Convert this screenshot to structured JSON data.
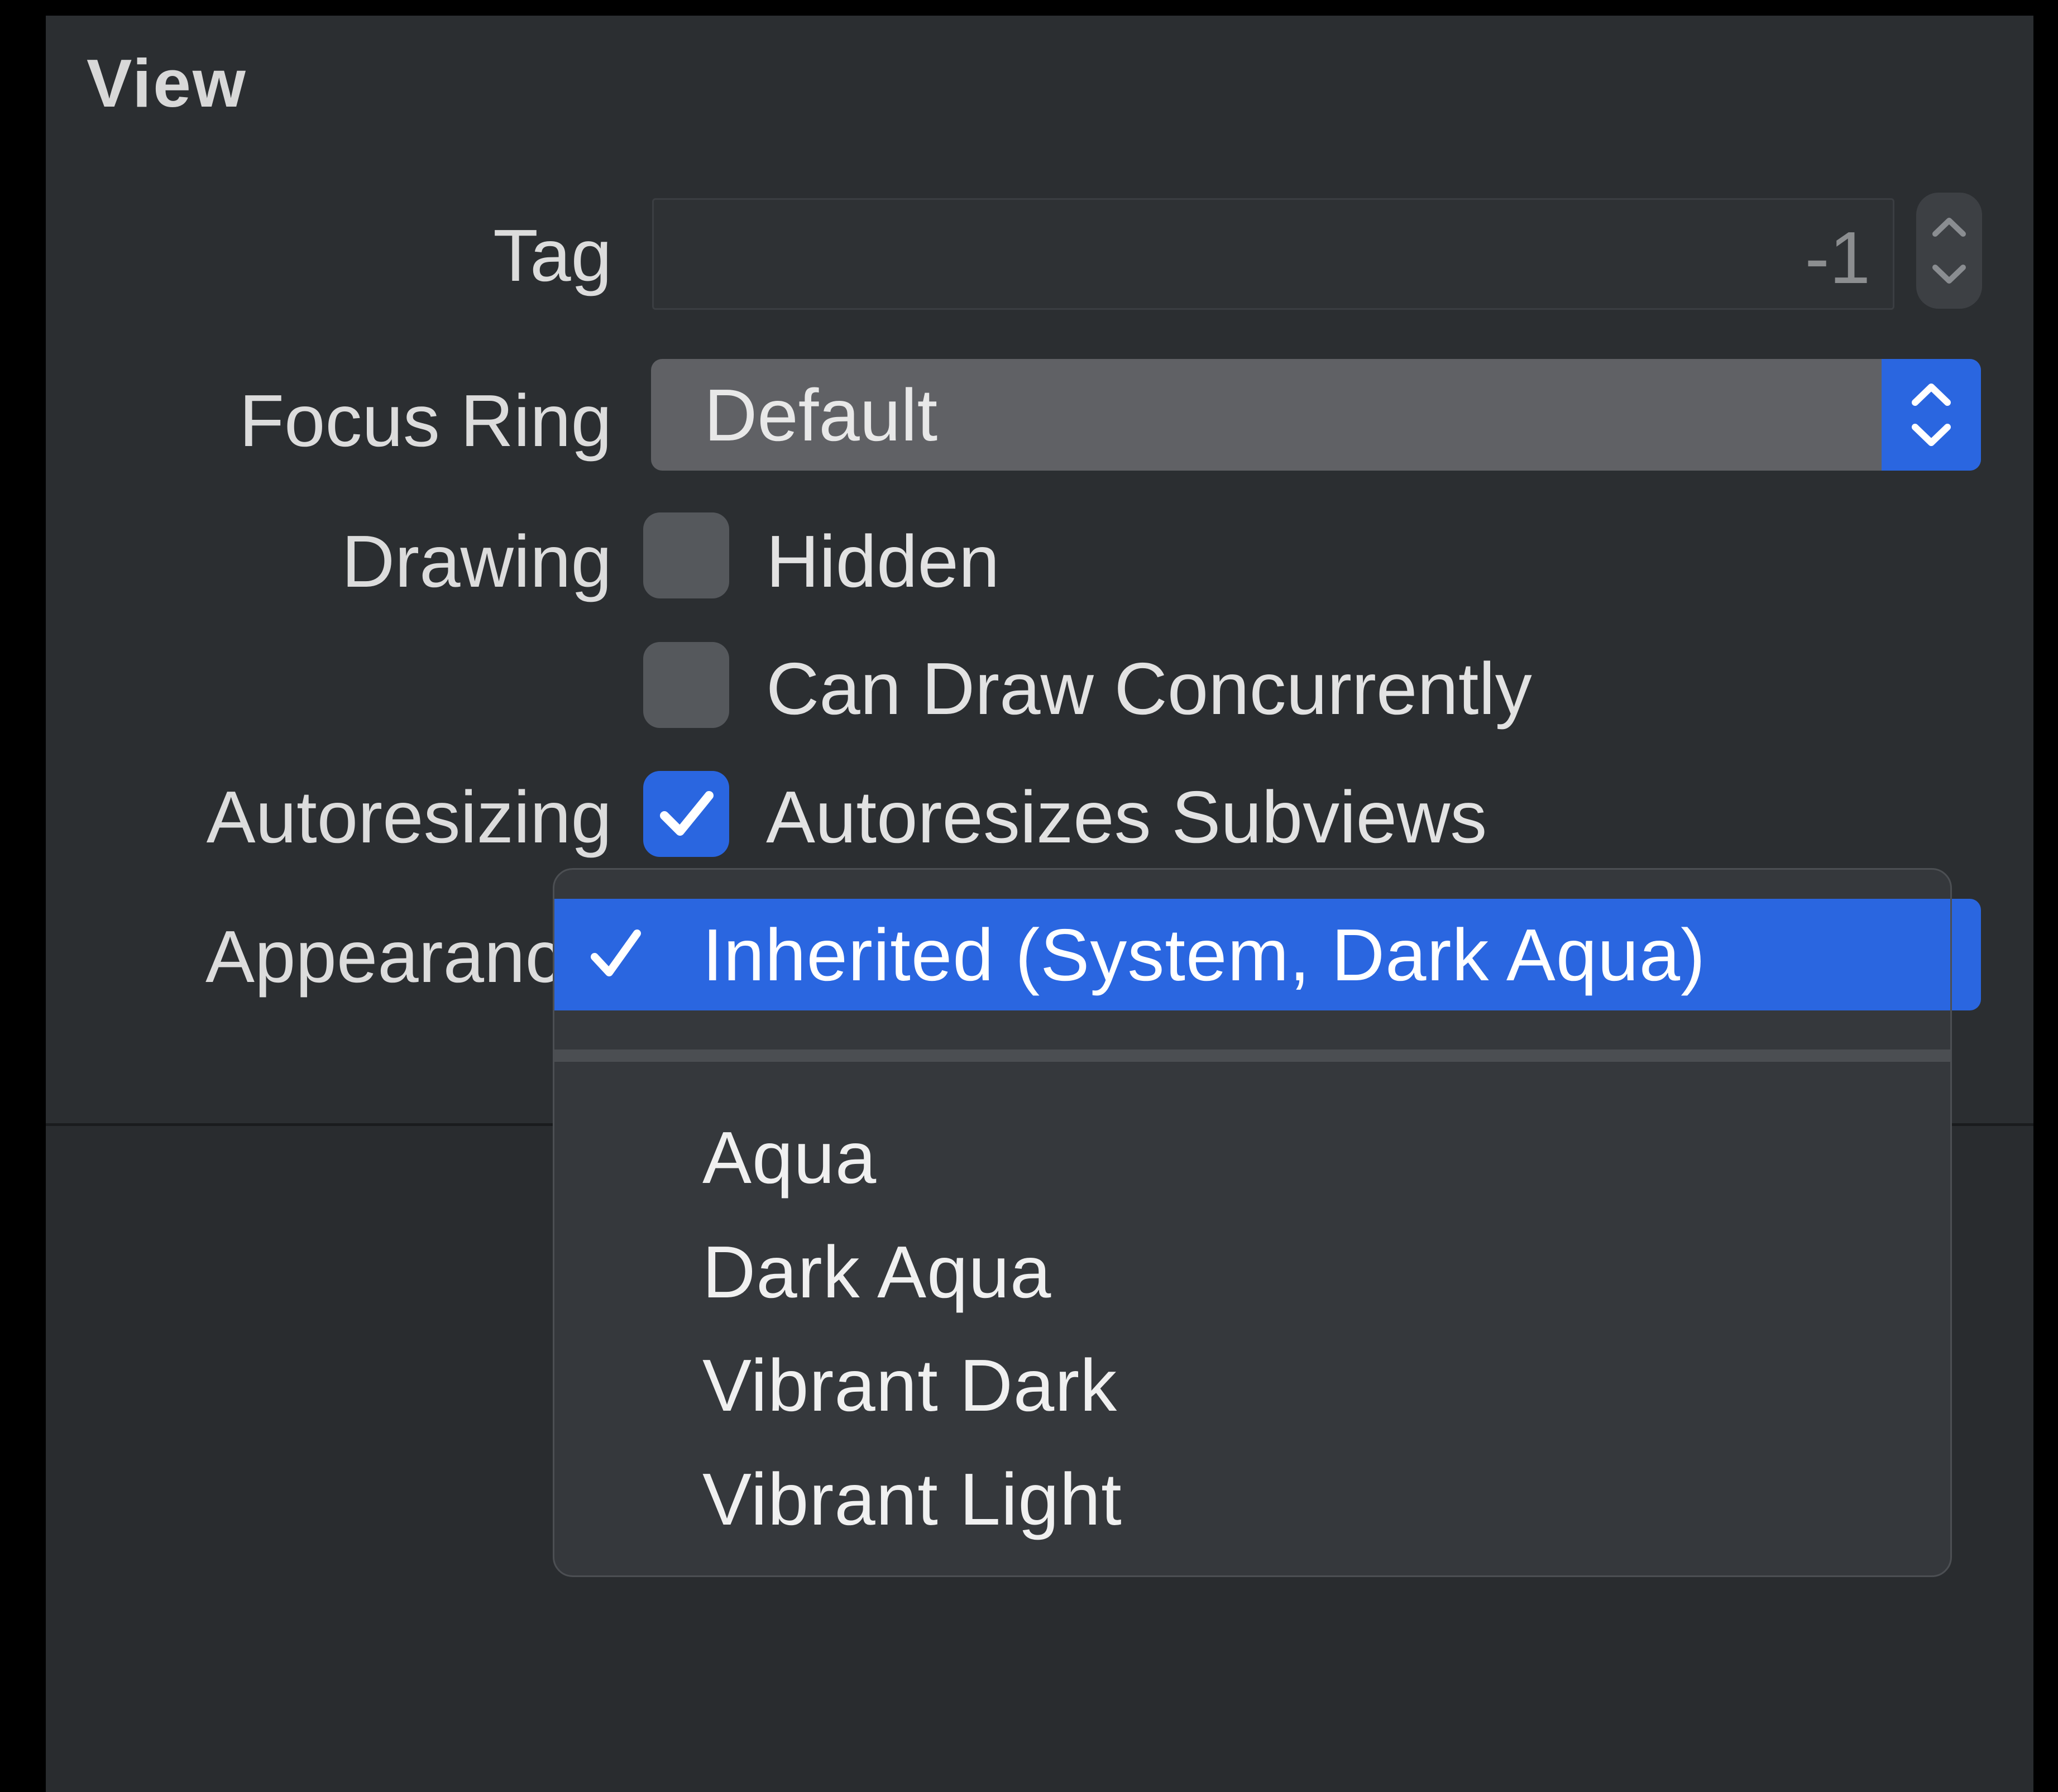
{
  "section": {
    "title": "View"
  },
  "tag": {
    "label": "Tag",
    "value": "-1"
  },
  "focus_ring": {
    "label": "Focus Ring",
    "value": "Default"
  },
  "drawing": {
    "label": "Drawing",
    "hidden_label": "Hidden",
    "hidden_checked": false,
    "concurrent_label": "Can Draw Concurrently",
    "concurrent_checked": false
  },
  "autoresizing": {
    "label": "Autoresizing",
    "subviews_label": "Autoresizes Subviews",
    "subviews_checked": true
  },
  "appearance": {
    "label": "Appearance",
    "visible_label": "Appearanc",
    "menu": {
      "selected": "Inherited (System, Dark Aqua)",
      "options": [
        "Aqua",
        "Dark Aqua",
        "Vibrant Dark",
        "Vibrant Light"
      ]
    }
  },
  "colors": {
    "panel_background": "#2b2e31",
    "accent": "#2a66e0",
    "menu_background": "#35383c"
  }
}
